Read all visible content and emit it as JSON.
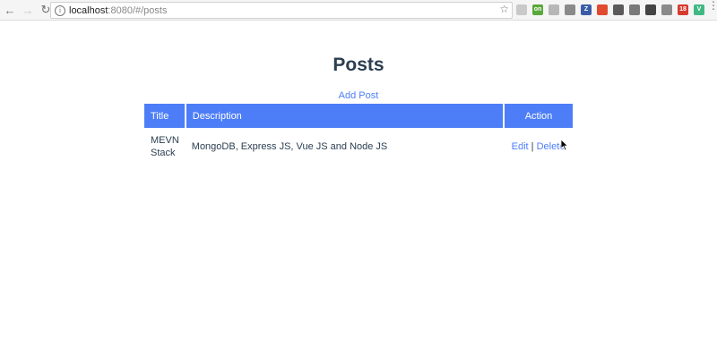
{
  "browser": {
    "back_icon": "←",
    "forward_icon": "→",
    "reload_icon": "↻",
    "info_icon": "i",
    "url_host": "localhost",
    "url_rest": ":8080/#/posts",
    "bookmark_icon": "☆",
    "menu_icon": "⋮",
    "extensions": [
      {
        "name": "ext-cloud-icon",
        "color": "#c9c9c9",
        "text": ""
      },
      {
        "name": "ext-green-icon",
        "color": "#5aa83b",
        "text": "on"
      },
      {
        "name": "ext-page-icon",
        "color": "#b7b7b7",
        "text": ""
      },
      {
        "name": "ext-grid-icon",
        "color": "#8a8a8a",
        "text": ""
      },
      {
        "name": "ext-z-icon",
        "color": "#3b5da8",
        "text": "Z"
      },
      {
        "name": "ext-red-icon",
        "color": "#e04a2f",
        "text": ""
      },
      {
        "name": "ext-pen-icon",
        "color": "#5b5b5b",
        "text": ""
      },
      {
        "name": "ext-pin-icon",
        "color": "#7a7a7a",
        "text": ""
      },
      {
        "name": "ext-eye-icon",
        "color": "#444444",
        "text": ""
      },
      {
        "name": "ext-bug-icon",
        "color": "#8a8a8a",
        "text": ""
      },
      {
        "name": "ext-badge-icon",
        "color": "#d63b2f",
        "text": "18"
      },
      {
        "name": "ext-vue-icon",
        "color": "#41b883",
        "text": "V"
      }
    ]
  },
  "page": {
    "title": "Posts",
    "add_post_label": "Add Post"
  },
  "table": {
    "headers": {
      "title": "Title",
      "description": "Description",
      "action": "Action"
    },
    "rows": [
      {
        "title": "MEVN Stack",
        "description": "MongoDB, Express JS, Vue JS and Node JS",
        "edit_label": "Edit",
        "separator": "|",
        "delete_label": "Delete"
      }
    ]
  },
  "colors": {
    "accent": "#4d7ef7",
    "text": "#2c3e50"
  }
}
